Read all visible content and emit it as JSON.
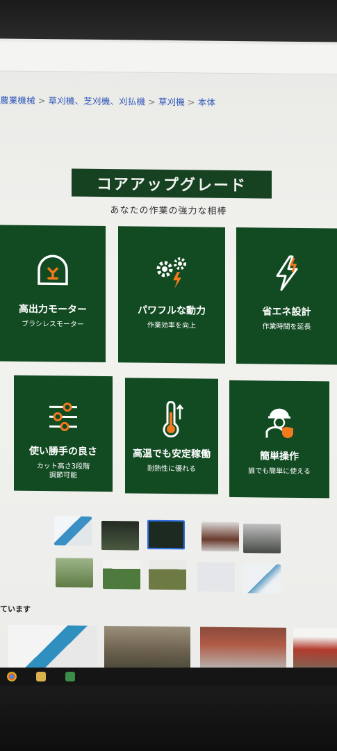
{
  "breadcrumb": {
    "items": [
      "農業機械",
      "草刈機、芝刈機、刈払機",
      "草刈機",
      "本体"
    ],
    "separator": ">"
  },
  "hero": {
    "banner": "コアアップグレード",
    "subtitle": "あなたの作業の強力な相棒"
  },
  "features": [
    {
      "icon": "motor-icon",
      "title": "高出力モーター",
      "subtitle": "ブラシレスモーター"
    },
    {
      "icon": "gears-lightning-icon",
      "title": "パワフルな動力",
      "subtitle": "作業効率を向上"
    },
    {
      "icon": "lightning-icon",
      "title": "省エネ設計",
      "subtitle": "作業時間を延長"
    },
    {
      "icon": "sliders-icon",
      "title": "使い勝手の良さ",
      "subtitle": "カット高さ3段階\n調節可能"
    },
    {
      "icon": "thermometer-icon",
      "title": "高温でも安定稼働",
      "subtitle": "耐熱性に優れる"
    },
    {
      "icon": "worker-shield-icon",
      "title": "簡単操作",
      "subtitle": "誰でも簡単に使える"
    }
  ],
  "gallery": {
    "selected_index": 2,
    "count": 10
  },
  "related": {
    "label": "ています"
  },
  "colors": {
    "card_green": "#124a22",
    "banner_green": "#174222",
    "accent_orange": "#f07a1c",
    "link_blue": "#2d55b8",
    "selected_border": "#2f6fe0"
  }
}
